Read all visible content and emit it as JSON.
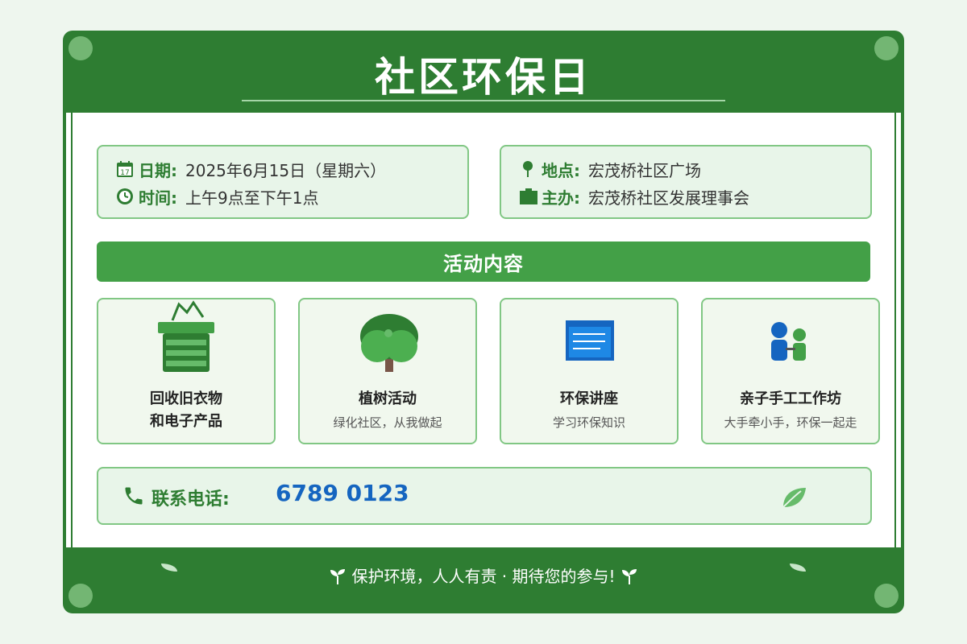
{
  "title": "社区环保日",
  "info": {
    "date_label": "日期:",
    "date_value": "2025年6月15日（星期六）",
    "time_label": "时间:",
    "time_value": "上午9点至下午1点",
    "place_label": "地点:",
    "place_value": "宏茂桥社区广场",
    "host_label": "主办:",
    "host_value": "宏茂桥社区发展理事会"
  },
  "section_title": "活动内容",
  "activities": [
    {
      "title_line1": "回收旧衣物",
      "title_line2": "和电子产品",
      "subtitle": "",
      "icon": "recycle-bin-icon"
    },
    {
      "title_line1": "植树活动",
      "title_line2": "",
      "subtitle": "绿化社区，从我做起",
      "icon": "tree-icon"
    },
    {
      "title_line1": "环保讲座",
      "title_line2": "",
      "subtitle": "学习环保知识",
      "icon": "presentation-board-icon"
    },
    {
      "title_line1": "亲子手工工作坊",
      "title_line2": "",
      "subtitle": "大手牵小手，环保一起走",
      "icon": "parent-child-icon"
    }
  ],
  "contact": {
    "label": "联系电话:",
    "number": "6789 0123"
  },
  "footer": "保护环境，人人有责 · 期待您的参与!",
  "colors": {
    "primary": "#2e7d32",
    "accent": "#43a047",
    "light": "#e8f5e9",
    "border": "#81c784",
    "phone": "#1565c0"
  }
}
